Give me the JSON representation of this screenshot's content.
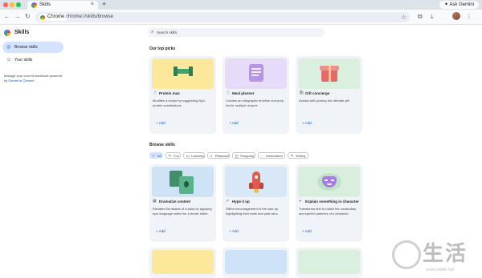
{
  "browser": {
    "tab_title": "Skills",
    "new_tab_icon": "plus-icon",
    "ask_gemini_label": "Ask Gemini",
    "chrome_label": "Chrome",
    "url": "chrome://skills/browse"
  },
  "sidebar": {
    "title": "Skills",
    "items": [
      {
        "label": "Browse skills",
        "icon": "compass-icon",
        "active": true
      },
      {
        "label": "Your skills",
        "icon": "person-icon",
        "active": false
      }
    ],
    "note_prefix": "Manage your current workflows powered by ",
    "note_link": "Gemini in Chrome"
  },
  "search": {
    "placeholder": "Search skills"
  },
  "top_picks": {
    "heading": "Our top picks",
    "cards": [
      {
        "title": "Protein max",
        "icon": "utensils-icon",
        "description": "Modifies a recipe by suggesting high-protein substitutions.",
        "add_label": "+ Add",
        "accent": "#fbe89a"
      },
      {
        "title": "Meal planner",
        "icon": "utensils-icon",
        "description": "Creates an infographic timeline and prep list for multiple recipes",
        "add_label": "+ Add",
        "accent": "#e6dcf7"
      },
      {
        "title": "Gift concierge",
        "icon": "bag-icon",
        "description": "Assists with picking the ultimate gift",
        "add_label": "+ Add",
        "accent": "#dbefdf"
      }
    ]
  },
  "browse": {
    "heading": "Browse skills",
    "filters": [
      {
        "label": "All",
        "icon": "check-icon",
        "selected": true
      },
      {
        "label": "Fun",
        "icon": "pen-icon",
        "selected": false
      },
      {
        "label": "Learning",
        "icon": "book-icon",
        "selected": false
      },
      {
        "label": "Research",
        "icon": "lines-icon",
        "selected": false
      },
      {
        "label": "Shopping",
        "icon": "bag-icon",
        "selected": false
      },
      {
        "label": "Understand",
        "icon": "bulb-icon",
        "selected": false
      },
      {
        "label": "Writing",
        "icon": "pen-icon",
        "selected": false
      }
    ],
    "cards": [
      {
        "title": "Dramatize content",
        "icon": "theater-icon",
        "description": "Elevates the stakes of a story by applying epic language suited for a movie trailer.",
        "add_label": "+ Add",
        "accent": "#cfe3f7"
      },
      {
        "title": "Hype it up",
        "icon": "rocket-icon",
        "description": "Offers encouragement to the user by highlighting their traits and past wins.",
        "add_label": "+ Add",
        "accent": "#d8e8f6"
      },
      {
        "title": "Explain something in character",
        "icon": "mask-icon",
        "description": "Transforms text to match the vocabulary and speech patterns of a character.",
        "add_label": "+ Add",
        "accent": "#d9eedd"
      }
    ]
  },
  "watermark": {
    "text": "生活",
    "url": "www.3elife.net",
    "icon": "watermark-circle-icon"
  }
}
